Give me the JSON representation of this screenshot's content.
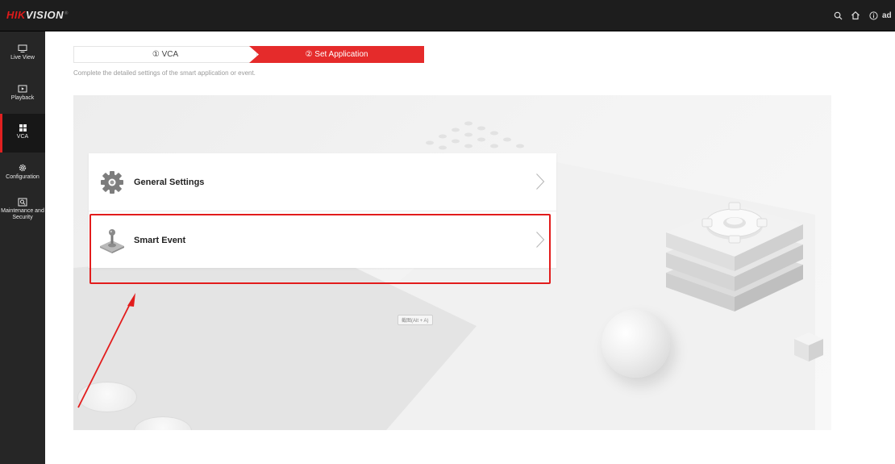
{
  "brand": {
    "logo_red": "HIK",
    "logo_rest": "VISION",
    "logo_mark": "®"
  },
  "topbar": {
    "icons": [
      "search-icon",
      "home-icon",
      "info-icon"
    ],
    "user_text": "ad"
  },
  "nav": {
    "items": [
      {
        "label": "Live View",
        "icon": "monitor-icon",
        "active": false
      },
      {
        "label": "Playback",
        "icon": "playback-icon",
        "active": false
      },
      {
        "label": "VCA",
        "icon": "grid-icon",
        "active": true
      },
      {
        "label": "Configuration",
        "icon": "gear-icon",
        "active": false
      },
      {
        "label": "Maintenance and Security",
        "icon": "maintenance-icon",
        "active": false
      }
    ]
  },
  "steps": {
    "step1": "① VCA",
    "step2": "② Set Application"
  },
  "description": "Complete the detailed settings of the smart application or event.",
  "menu": {
    "items": [
      {
        "label": "General Settings",
        "icon": "gear-icon"
      },
      {
        "label": "Smart Event",
        "icon": "joystick-icon"
      }
    ]
  },
  "tooltip": "截图(Alt + A)",
  "colors": {
    "accent": "#e52b2b",
    "topbar_bg": "#1d1d1d",
    "nav_bg": "#262626",
    "annotation": "#e21c1c"
  }
}
